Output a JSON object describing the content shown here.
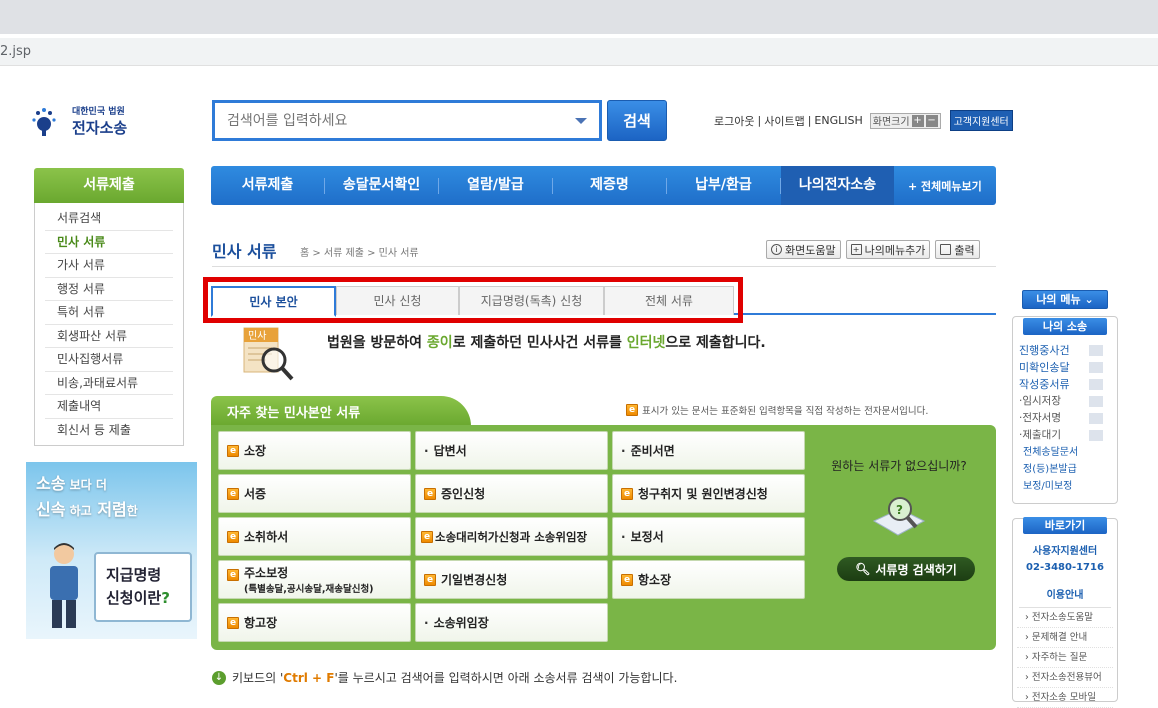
{
  "browser": {
    "url": "2.jsp"
  },
  "logo": {
    "line1": "대한민국 법원",
    "line2": "전자소송"
  },
  "search": {
    "placeholder": "검색어를 입력하세요",
    "button": "검색"
  },
  "util": {
    "logout": "로그아웃",
    "sitemap": "사이트맵",
    "english": "ENGLISH",
    "zoom_label": "화면크기",
    "zoom_in": "+",
    "zoom_out": "−",
    "support": "고객지원센터",
    "sep": "|"
  },
  "gnb": {
    "items": [
      "서류제출",
      "송달문서확인",
      "열람/발급",
      "제증명",
      "납부/환급",
      "나의전자소송"
    ],
    "all_menu": "+ 전체메뉴보기"
  },
  "lnb": {
    "title": "서류제출",
    "items": [
      "서류검색",
      "민사 서류",
      "가사 서류",
      "행정 서류",
      "특허 서류",
      "회생파산 서류",
      "민사집행서류",
      "비송,과태료서류",
      "제출내역",
      "회신서 등 제출"
    ]
  },
  "banner": {
    "line1a": "소송",
    "line1b": "보다 더",
    "line2a": "신속",
    "line2b": "하고",
    "line2c": "저렴",
    "line2d": "한",
    "cal1": "지급명령",
    "cal2a": "신청이란",
    "cal2b": "?"
  },
  "page": {
    "title": "민사 서류",
    "breadcrumb": "홈 > 서류 제출 > 민사 서류",
    "help": "화면도움말",
    "add_menu": "나의메뉴추가",
    "print": "출력"
  },
  "tabs": [
    "민사 본안",
    "민사 신청",
    "지급명령(독촉) 신청",
    "전체 서류"
  ],
  "intro": {
    "icon_label": "민사",
    "p1": "법원을 방문하여 ",
    "p2": "종이",
    "p3": "로 제출하던 민사사건 서류를 ",
    "p4": "인터넷",
    "p5": "으로 제출합니다."
  },
  "freq": {
    "title": "자주 찾는 민사본안 서류",
    "note": "표시가 있는 문서는 표준화된 입력항목을 직접 작성하는 전자문서입니다.",
    "cells": [
      {
        "label": "소장",
        "e": true
      },
      {
        "label": "답변서",
        "e": false
      },
      {
        "label": "준비서면",
        "e": false
      },
      {
        "label": "서증",
        "e": true
      },
      {
        "label": "증인신청",
        "e": true
      },
      {
        "label": "청구취지 및 원인변경신청",
        "e": true
      },
      {
        "label": "소취하서",
        "e": true
      },
      {
        "label": "소송대리허가신청과 소송위임장",
        "e": true
      },
      {
        "label": "보정서",
        "e": false
      },
      {
        "label": "주소보정",
        "sub": "(특별송달,공시송달,재송달신청)",
        "e": true
      },
      {
        "label": "기일변경신청",
        "e": true
      },
      {
        "label": "항소장",
        "e": true
      },
      {
        "label": "항고장",
        "e": true
      },
      {
        "label": "소송위임장",
        "e": false
      }
    ],
    "question": "원하는 서류가 없으십니까?",
    "search_btn": "서류명 검색하기"
  },
  "keyboard_note": {
    "p1": "키보드의 '",
    "key": "Ctrl + F",
    "p2": "'를 누르시고 검색어를 입력하시면 아래 소송서류 검색이 가능합니다."
  },
  "right": {
    "my_menu": "나의 메뉴 ⌄",
    "my_case": "나의 소송",
    "case_links": [
      "진행중사건",
      "미확인송달",
      "작성중서류"
    ],
    "case_sub": [
      "·임시저장",
      "·전자서명",
      "·제출대기"
    ],
    "case_links2": [
      "전체송달문서",
      "정(등)본발급",
      "보정/미보정"
    ],
    "go": "바로가기",
    "center": "사용자지원센터",
    "phone": "02-3480-1716",
    "usage": "이용안내",
    "links": [
      "전자소송도움말",
      "문제해결 안내",
      "자주하는 질문",
      "전자소송전용뷰어",
      "전자소송 모바일"
    ]
  }
}
